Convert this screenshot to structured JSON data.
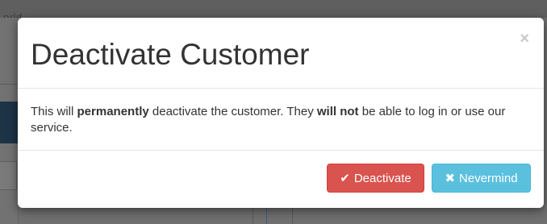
{
  "background": {
    "topbar_text": "orld"
  },
  "modal": {
    "title": "Deactivate Customer",
    "close_glyph": "×",
    "body": {
      "part1": "This will ",
      "bold1": "permanently",
      "part2": " deactivate the customer. They ",
      "bold2": "will not",
      "part3": " be able to log in or use our service."
    },
    "buttons": {
      "deactivate": {
        "icon": "check-icon",
        "glyph": "✔",
        "label": "Deactivate",
        "color": "#d9534f"
      },
      "nevermind": {
        "icon": "close-icon",
        "glyph": "✖",
        "label": "Nevermind",
        "color": "#5bc0de"
      }
    }
  },
  "colors": {
    "backdrop": "#6f6f6f",
    "title_text": "#333333",
    "danger": "#d9534f",
    "info": "#5bc0de"
  }
}
